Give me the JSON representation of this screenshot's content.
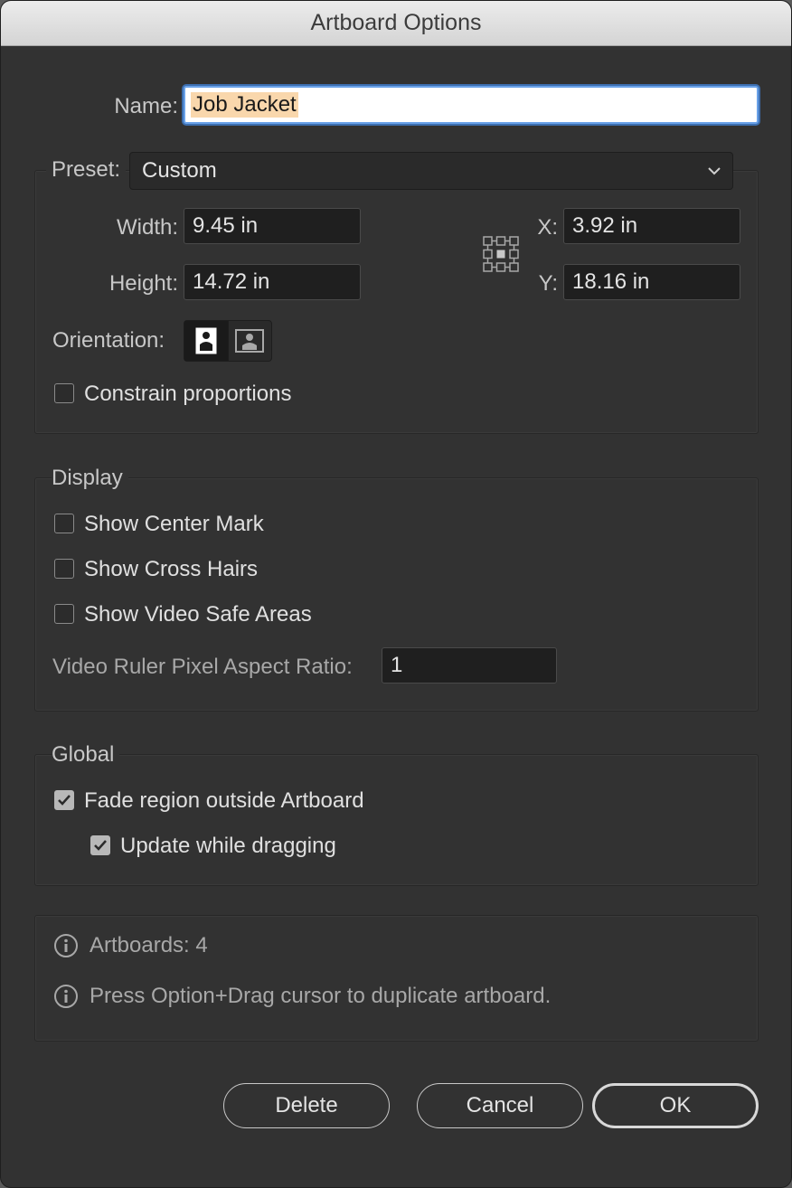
{
  "window": {
    "title": "Artboard Options"
  },
  "name": {
    "label": "Name:",
    "value": "Job Jacket"
  },
  "preset": {
    "label": "Preset:",
    "value": "Custom"
  },
  "size": {
    "width_label": "Width:",
    "width_value": "9.45 in",
    "height_label": "Height:",
    "height_value": "14.72 in",
    "x_label": "X:",
    "x_value": "3.92 in",
    "y_label": "Y:",
    "y_value": "18.16 in",
    "orientation_label": "Orientation:",
    "constrain_label": "Constrain proportions",
    "constrain_checked": false
  },
  "display": {
    "title": "Display",
    "center_mark": "Show Center Mark",
    "cross_hairs": "Show Cross Hairs",
    "video_safe": "Show Video Safe Areas",
    "aspect_label": "Video Ruler Pixel Aspect Ratio:",
    "aspect_value": "1"
  },
  "global": {
    "title": "Global",
    "fade_label": "Fade region outside Artboard",
    "fade_checked": true,
    "update_label": "Update while dragging",
    "update_checked": true
  },
  "info": {
    "artboards": "Artboards: 4",
    "tip": "Press Option+Drag cursor to duplicate artboard."
  },
  "buttons": {
    "delete": "Delete",
    "cancel": "Cancel",
    "ok": "OK"
  },
  "colors": {
    "accent": "#6aa2e8",
    "highlight": "#f9d7ac",
    "background": "#323232"
  }
}
